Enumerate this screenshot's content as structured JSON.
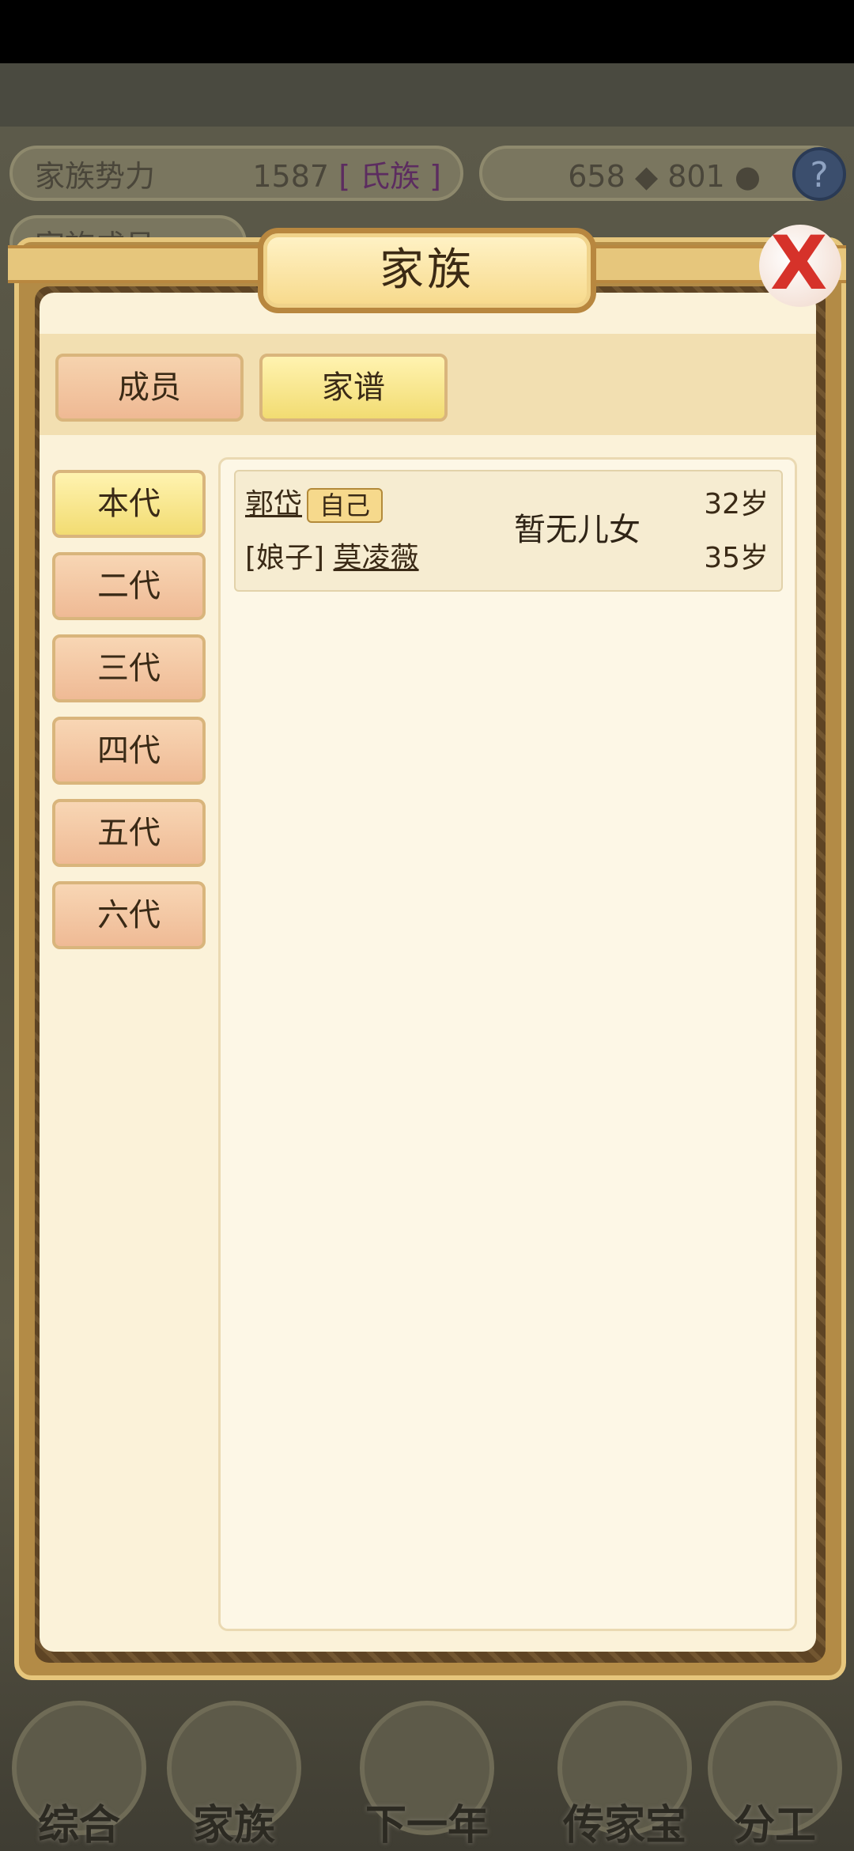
{
  "background": {
    "stats": {
      "clan_power_label": "家族势力",
      "clan_power_value": "1587",
      "clan_power_rank": "[ 氏族 ]",
      "silver_value": "658",
      "coin_value": "801",
      "members_label": "家族成员"
    },
    "help_label": "?",
    "bottom_nav": [
      "综合",
      "家族",
      "下一年",
      "传家宝",
      "分工"
    ]
  },
  "dialog": {
    "title": "家族",
    "close_label": "X",
    "tabs": [
      "成员",
      "家谱"
    ],
    "generations": [
      "本代",
      "二代",
      "三代",
      "四代",
      "五代",
      "六代"
    ],
    "family": {
      "self_name": "郭岱",
      "self_badge": "自己",
      "self_age": "32岁",
      "spouse_role": "[娘子]",
      "spouse_name": "莫凌薇",
      "spouse_age": "35岁",
      "children_text": "暂无儿女"
    }
  }
}
